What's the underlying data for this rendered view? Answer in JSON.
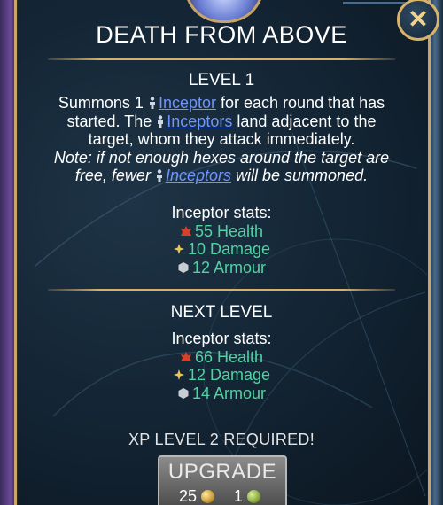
{
  "dialog": {
    "title": "DEATH FROM ABOVE",
    "close_icon": "close-x-icon"
  },
  "current_level": {
    "heading": "LEVEL 1",
    "desc_line1_pre": "Summons 1",
    "desc_line1_link": "Inceptor",
    "desc_line1_post": "for each round that has",
    "desc_line2_pre": "started. The",
    "desc_line2_link": "Inceptors",
    "desc_line2_post": "land adjacent to the",
    "desc_line3": "target, whom they attack immediately.",
    "note_line1": "Note: if not enough hexes around the target are",
    "note_line2_pre": "free, fewer",
    "note_line2_link": "Inceptors",
    "note_line2_post": "will be summoned.",
    "stats_label": "Inceptor stats:",
    "health": "55 Health",
    "damage": "10 Damage",
    "armour": "12 Armour"
  },
  "next_level": {
    "heading": "NEXT LEVEL",
    "stats_label": "Inceptor stats:",
    "health": "66 Health",
    "damage": "12 Damage",
    "armour": "14 Armour"
  },
  "requirement": "XP LEVEL 2 REQUIRED!",
  "upgrade": {
    "label": "UPGRADE",
    "gold_cost": "25",
    "green_cost": "1"
  },
  "icons": {
    "unit": "inceptor-unit-icon",
    "health": "health-icon",
    "damage": "damage-icon",
    "armour": "armour-icon",
    "gold": "gold-coin-icon",
    "green": "green-token-icon"
  },
  "colors": {
    "link": "#6e94ff",
    "stat": "#4fd3a1",
    "gold_trim": "#d8b06a"
  }
}
